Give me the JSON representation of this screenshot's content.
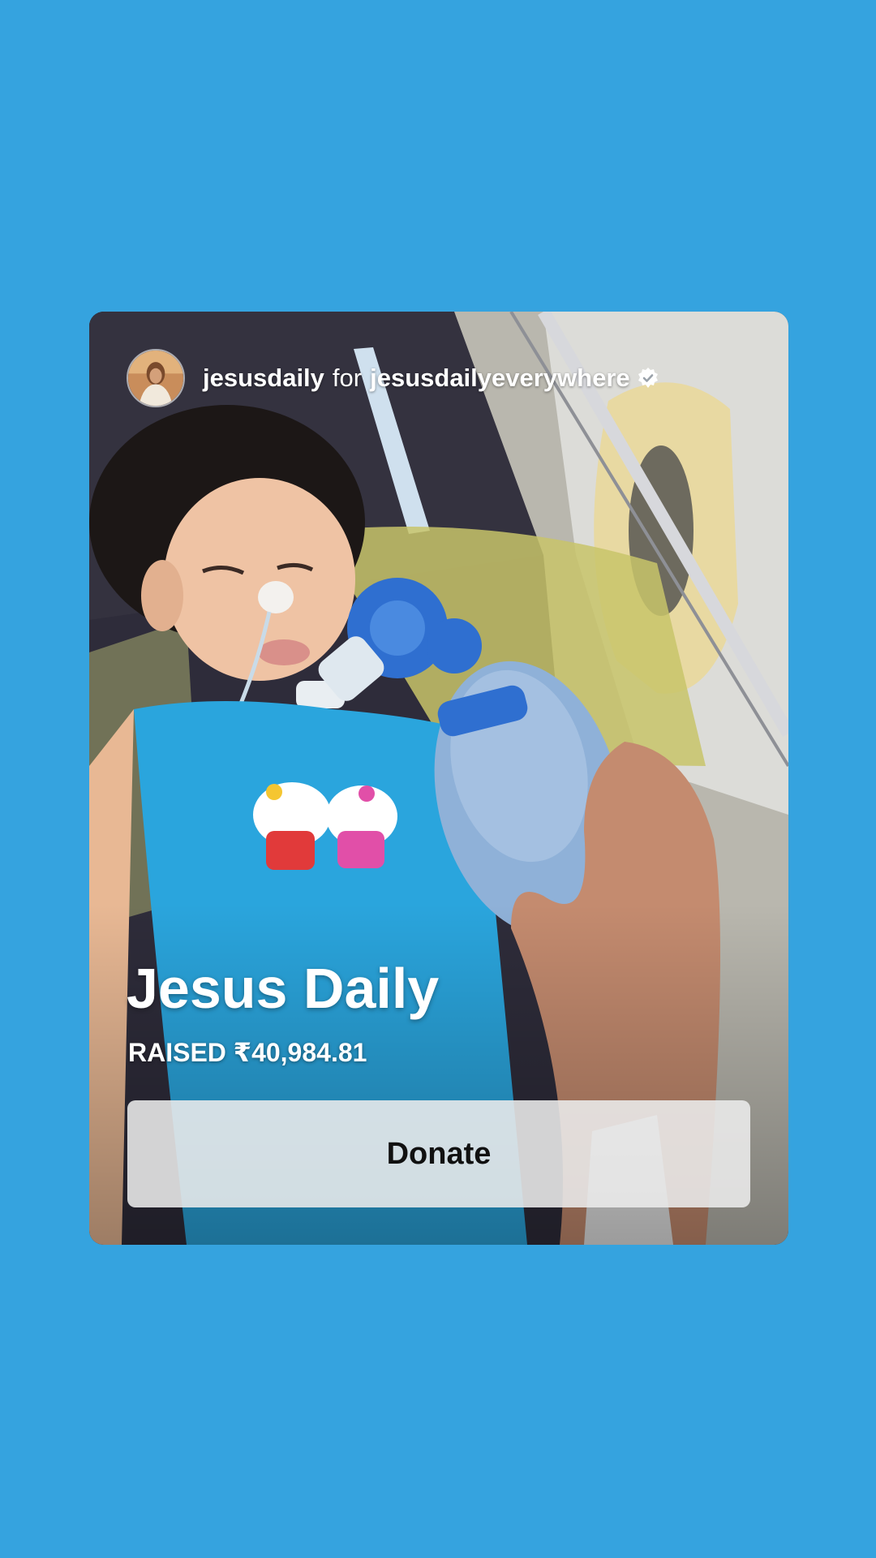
{
  "card": {
    "author": "jesusdaily",
    "connector": "for",
    "beneficiary": "jesusdailyeverywhere",
    "avatar_icon": "profile-avatar",
    "verified_icon": "verified-badge-icon",
    "fundraiser_title": "Jesus Daily",
    "raised_label": "RAISED ₹40,984.81",
    "donate_label": "Donate"
  },
  "colors": {
    "background": "#35a3df",
    "button_background": "#ececec"
  }
}
